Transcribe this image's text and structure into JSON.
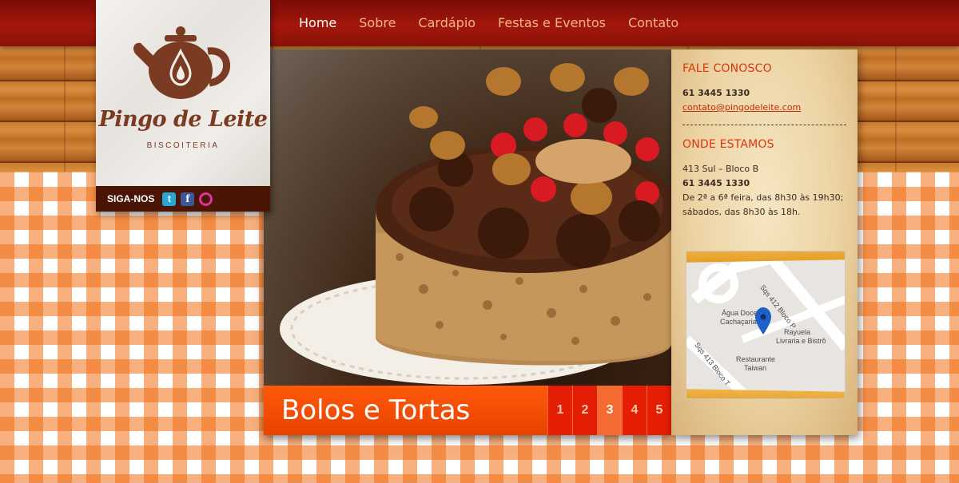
{
  "nav": {
    "items": [
      {
        "label": "Home",
        "active": true
      },
      {
        "label": "Sobre",
        "active": false
      },
      {
        "label": "Cardápio",
        "active": false
      },
      {
        "label": "Festas e Eventos",
        "active": false
      },
      {
        "label": "Contato",
        "active": false
      }
    ]
  },
  "brand": {
    "name": "Pingo de Leite",
    "tagline": "BISCOITERIA",
    "logo_icon": "teapot-icon"
  },
  "social": {
    "label": "SIGA-NOS",
    "icons": [
      "twitter-icon",
      "facebook-icon",
      "flickr-icon"
    ]
  },
  "hero": {
    "title": "Bolos e Tortas",
    "pages": [
      "1",
      "2",
      "3",
      "4",
      "5"
    ],
    "active_page": "3"
  },
  "contact": {
    "heading": "FALE CONOSCO",
    "phone": "61 3445 1330",
    "email": "contato@pingodeleite.com"
  },
  "location": {
    "heading": "ONDE ESTAMOS",
    "address": "413 Sul – Bloco B",
    "phone": "61 3445 1330",
    "hours_weekday": "De 2ª a 6ª feira, das 8h30 às 19h30;",
    "hours_saturday": "sábados, das 8h30 às 18h."
  },
  "map": {
    "labels": {
      "agua_doce": "Água Doce",
      "cachacaria": "Cachaçaria",
      "rayuela": "Rayuela",
      "livraria": "Livraria e Bistrô",
      "restaurante": "Restaurante",
      "taiwan": "Taiwan",
      "street_412": "Sqs 412 Bloco P",
      "street_413": "Sqs 413 Bloco T"
    }
  },
  "colors": {
    "accent_orange": "#ff5a0a",
    "nav_red": "#a3170c",
    "brand_brown": "#7b3a22",
    "heading_red": "#e0340c"
  }
}
